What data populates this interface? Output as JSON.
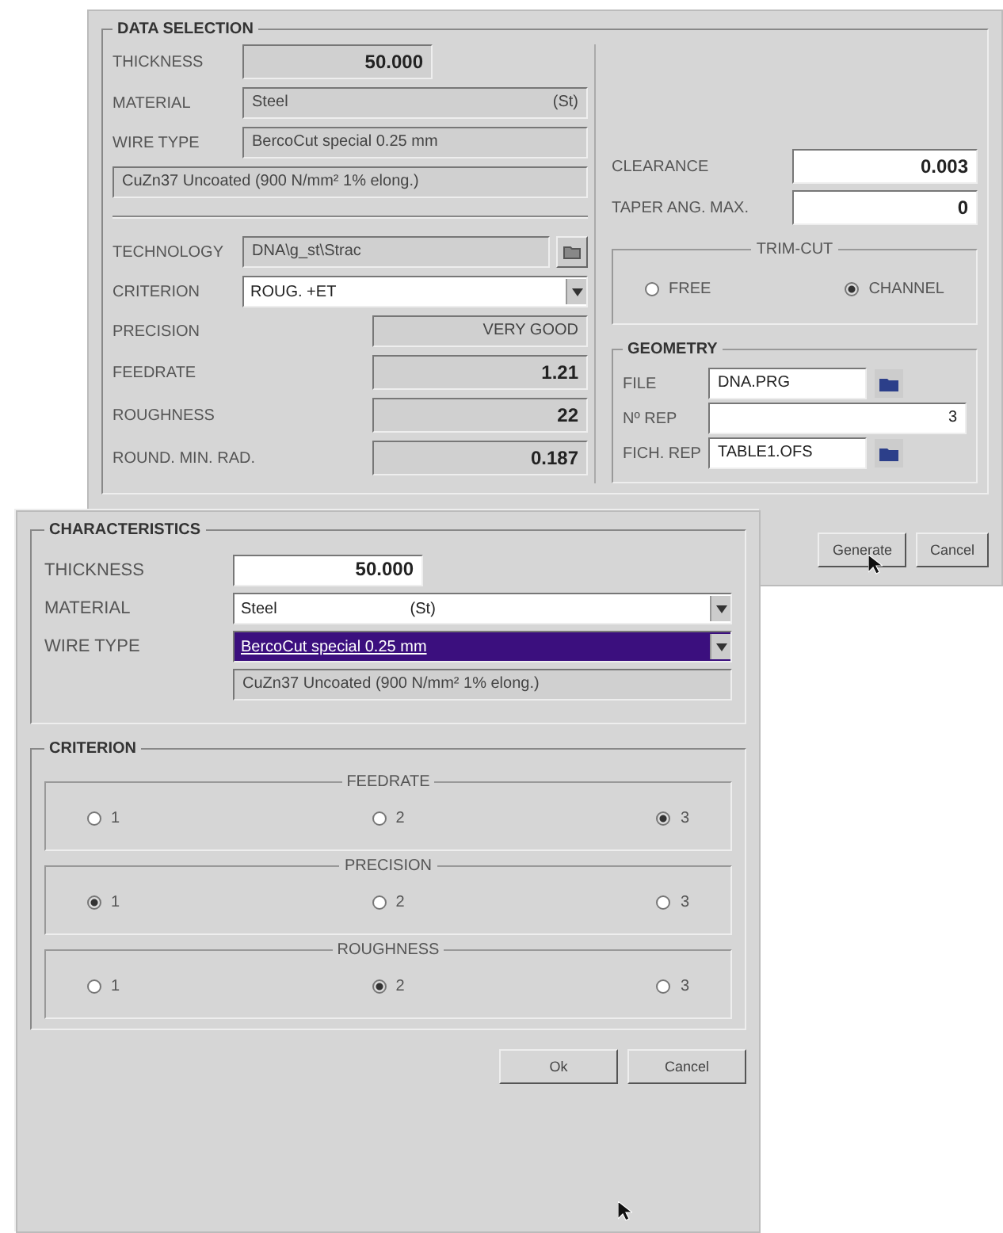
{
  "data_selection": {
    "title": "DATA SELECTION",
    "thickness": {
      "label": "THICKNESS",
      "value": "50.000"
    },
    "material": {
      "label": "MATERIAL",
      "value": "Steel",
      "code": "(St)"
    },
    "wire_type": {
      "label": "WIRE TYPE",
      "value": "BercoCut special 0.25 mm"
    },
    "wire_description": "CuZn37 Uncoated (900 N/mm² 1% elong.)",
    "technology": {
      "label": "TECHNOLOGY",
      "value": "DNA\\g_st\\Strac"
    },
    "criterion": {
      "label": "CRITERION",
      "value": "ROUG. +ET"
    },
    "results": [
      {
        "label": "PRECISION",
        "value": "VERY GOOD"
      },
      {
        "label": "FEEDRATE",
        "value": "1.21"
      },
      {
        "label": "ROUGHNESS",
        "value": "22"
      },
      {
        "label": "ROUND. MIN. RAD.",
        "value": "0.187"
      }
    ],
    "clearance": {
      "label": "CLEARANCE",
      "value": "0.003"
    },
    "taper": {
      "label": "TAPER ANG. MAX.",
      "value": "0"
    },
    "trim_cut": {
      "title": "TRIM-CUT",
      "options": [
        {
          "label": "FREE",
          "selected": false
        },
        {
          "label": "CHANNEL",
          "selected": true
        }
      ]
    },
    "geometry": {
      "title": "GEOMETRY",
      "fields": [
        {
          "label": "FILE",
          "value": "DNA.PRG",
          "kind": "browse"
        },
        {
          "label": "Nº REP",
          "value": "3",
          "kind": "number"
        },
        {
          "label": "FICH. REP",
          "value": "TABLE1.OFS",
          "kind": "browse"
        }
      ]
    },
    "buttons": [
      "Generate",
      "Cancel"
    ]
  },
  "characteristics_dialog": {
    "characteristics": {
      "title": "CHARACTERISTICS",
      "thickness": {
        "label": "THICKNESS",
        "value": "50.000"
      },
      "material": {
        "label": "MATERIAL",
        "value": "Steel",
        "code": "(St)",
        "selected": false
      },
      "wire_type": {
        "label": "WIRE TYPE",
        "value": "BercoCut special 0.25 mm",
        "selected": true
      },
      "wire_description": "CuZn37 Uncoated (900 N/mm² 1% elong.)"
    },
    "criterion": {
      "title": "CRITERION",
      "groups": [
        {
          "title": "FEEDRATE",
          "options": [
            {
              "label": "1",
              "selected": false
            },
            {
              "label": "2",
              "selected": false
            },
            {
              "label": "3",
              "selected": true
            }
          ]
        },
        {
          "title": "PRECISION",
          "options": [
            {
              "label": "1",
              "selected": true
            },
            {
              "label": "2",
              "selected": false
            },
            {
              "label": "3",
              "selected": false
            }
          ]
        },
        {
          "title": "ROUGHNESS",
          "options": [
            {
              "label": "1",
              "selected": false
            },
            {
              "label": "2",
              "selected": true
            },
            {
              "label": "3",
              "selected": false
            }
          ]
        }
      ]
    },
    "buttons": [
      "Ok",
      "Cancel"
    ]
  }
}
